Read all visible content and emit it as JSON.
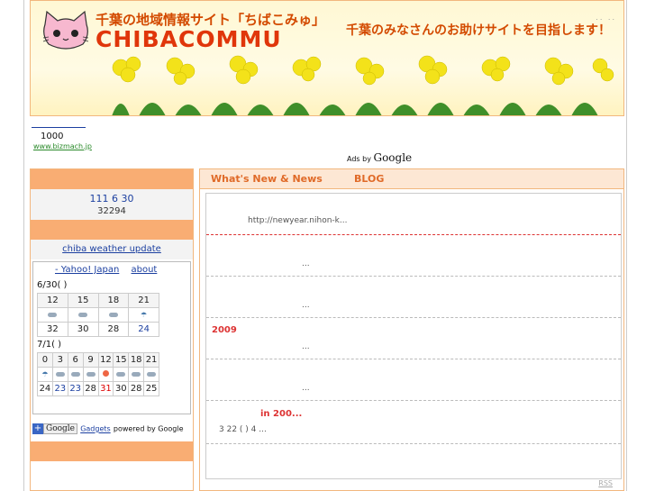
{
  "header": {
    "top_links": "..     ..",
    "title_jp": "千葉の地域情報サイト「ちばこみゅ」",
    "logo_text": "CHIBACOMMU",
    "tagline": "千葉のみなさんのお助けサイトを目指します！"
  },
  "banner": {
    "count": "1000",
    "url": "www.bizmach.jp",
    "ads_prefix": "Ads by",
    "ads_brand": "Google"
  },
  "sidebar": {
    "counter_line1": "111 6 30",
    "counter_line2": "32294",
    "weather_link": "chiba weather update",
    "weather_links": [
      "- Yahoo! Japan",
      "about"
    ],
    "day1": {
      "label": "6/30( )",
      "hours": [
        "12",
        "15",
        "18",
        "21"
      ],
      "icons": [
        "cloud-icon",
        "cloud-icon",
        "cloud-icon",
        "rain-icon"
      ],
      "temps": [
        "32",
        "30",
        "28",
        "24"
      ]
    },
    "day2": {
      "label": "7/1( )",
      "hours": [
        "0",
        "3",
        "6",
        "9",
        "12",
        "15",
        "18",
        "21"
      ],
      "icons": [
        "rain-icon",
        "cloud-icon",
        "cloud-icon",
        "cloud-icon",
        "sun-icon",
        "cloud-icon",
        "cloud-icon",
        "cloud-icon"
      ],
      "temps": [
        "24",
        "23",
        "23",
        "28",
        "31",
        "30",
        "28",
        "25"
      ]
    },
    "gadget": {
      "plus": "+",
      "button": "Google",
      "link": "Gadgets",
      "powered": "powered by Google"
    }
  },
  "main": {
    "tabs": [
      "What's New & News",
      "BLOG"
    ],
    "items": [
      {
        "text": "http://newyear.nihon-k..."
      },
      {
        "text": "..."
      },
      {
        "text": "..."
      },
      {
        "title": "2009",
        "text": "..."
      },
      {
        "text": "..."
      },
      {
        "title": "in  200...",
        "text": "3 22 ( )                    4  ..."
      }
    ],
    "rss": "RSS"
  }
}
